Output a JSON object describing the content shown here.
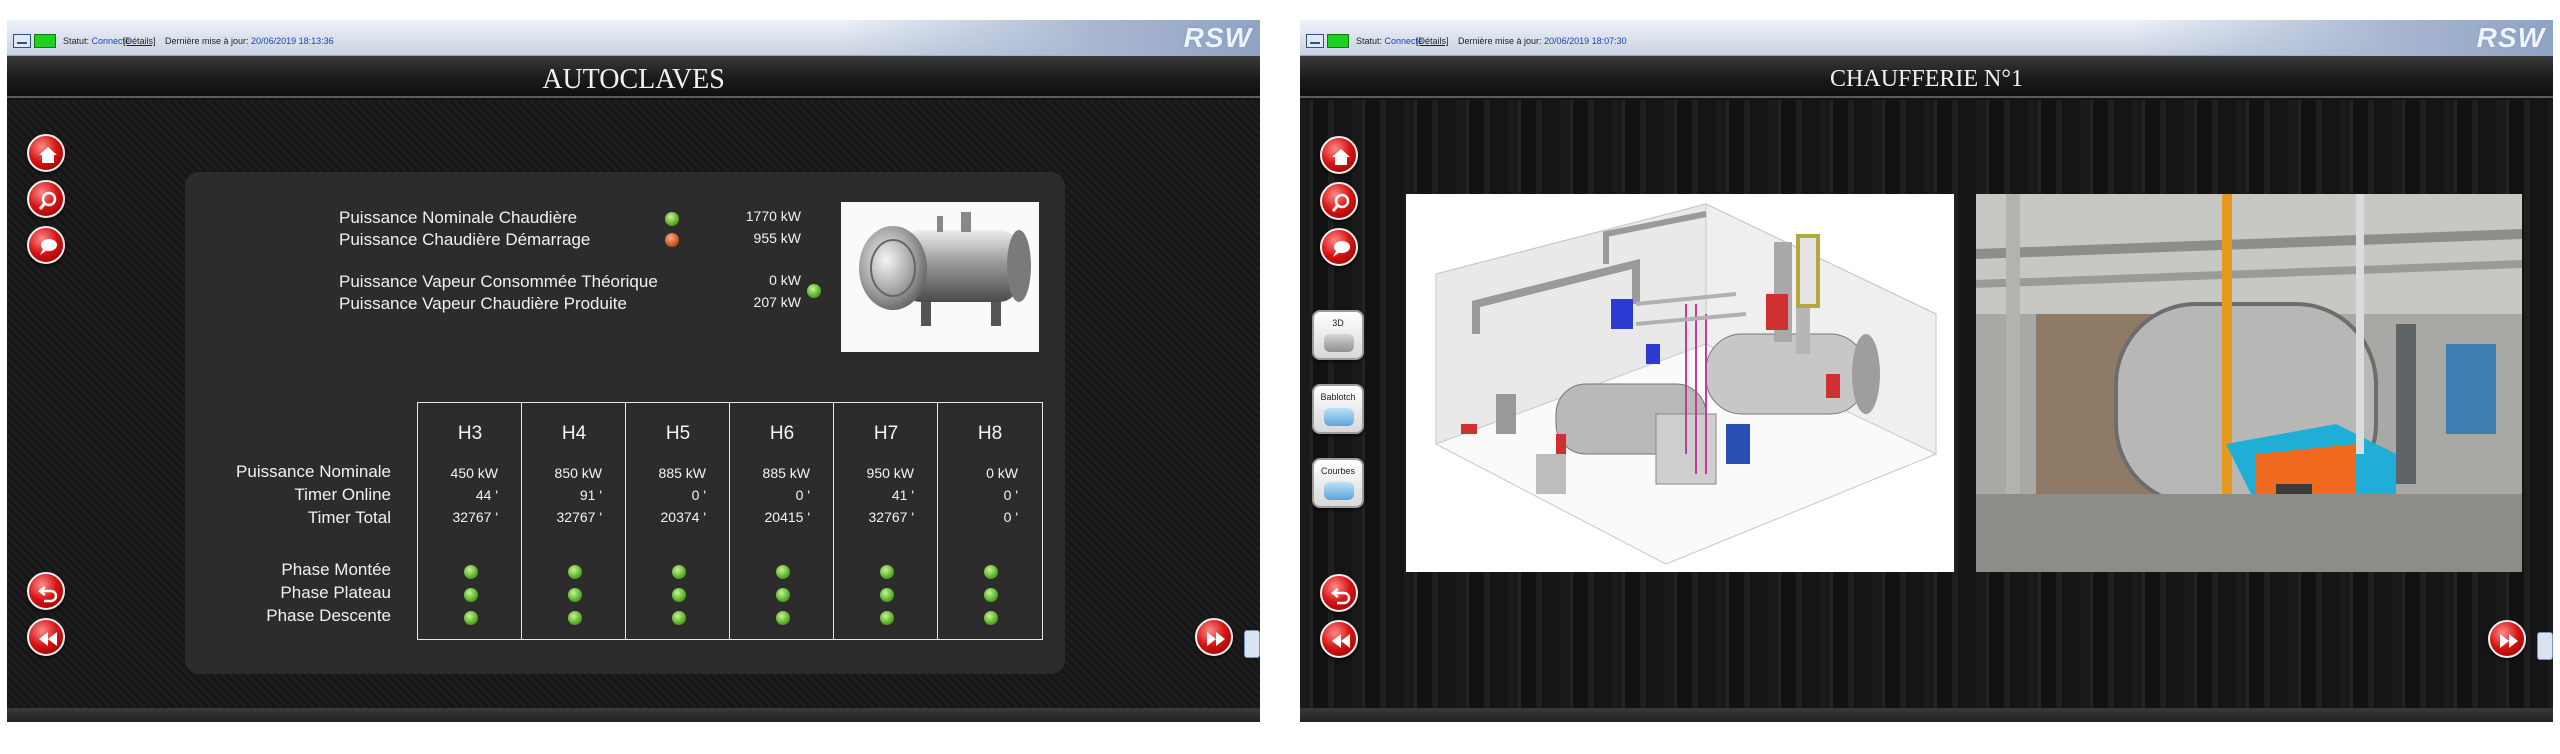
{
  "left_screen": {
    "status": {
      "label": "Statut:",
      "state": "Connecté",
      "details_link": "[Détails]",
      "update_label": "Dernière mise à jour:",
      "update_time": "20/06/2019 18:13:36",
      "logo": "RSW"
    },
    "title": "AUTOCLAVES",
    "power": {
      "nominale_label": "Puissance Nominale Chaudière",
      "nominale_value": "1770 kW",
      "nominale_led": "green",
      "demarrage_label": "Puissance Chaudière Démarrage",
      "demarrage_value": "955 kW",
      "demarrage_led": "red",
      "vapeur_conso_label": "Puissance Vapeur Consommée Théorique",
      "vapeur_conso_value": "0 kW",
      "vapeur_prod_label": "Puissance Vapeur Chaudière Produite",
      "vapeur_prod_value": "207 kW",
      "vapeur_led": "green"
    },
    "table": {
      "row_labels": [
        "Puissance Nominale",
        "Timer Online",
        "Timer Total"
      ],
      "phase_labels": [
        "Phase Montée",
        "Phase Plateau",
        "Phase Descente"
      ],
      "columns": [
        {
          "name": "H3",
          "nominale": "450 kW",
          "online": "44 '",
          "total": "32767 '"
        },
        {
          "name": "H4",
          "nominale": "850 kW",
          "online": "91 '",
          "total": "32767 '"
        },
        {
          "name": "H5",
          "nominale": "885 kW",
          "online": "0 '",
          "total": "20374 '"
        },
        {
          "name": "H6",
          "nominale": "885 kW",
          "online": "0 '",
          "total": "20415 '"
        },
        {
          "name": "H7",
          "nominale": "950 kW",
          "online": "41 '",
          "total": "32767 '"
        },
        {
          "name": "H8",
          "nominale": "0 kW",
          "online": "0 '",
          "total": "0 '"
        }
      ],
      "phase_led_color": "green"
    },
    "nav_icons": [
      "home-icon",
      "search-icon",
      "chat-icon",
      "back-icon",
      "rewind-icon",
      "fast-forward-icon"
    ]
  },
  "right_screen": {
    "status": {
      "label": "Statut:",
      "state": "Connecté",
      "details_link": "[Détails]",
      "update_label": "Dernière mise à jour:",
      "update_time": "20/06/2019 18:07:30",
      "logo": "RSW"
    },
    "title": "CHAUFFERIE N°1",
    "view_buttons": [
      "3D",
      "Bablotch",
      "Courbes"
    ],
    "nav_icons": [
      "home-icon",
      "search-icon",
      "chat-icon",
      "back-icon",
      "rewind-icon",
      "fast-forward-icon"
    ]
  },
  "colors": {
    "accent_red": "#d51414",
    "led_green": "#5fb52b",
    "led_red": "#d75a2a",
    "status_green": "#1fd11f"
  }
}
